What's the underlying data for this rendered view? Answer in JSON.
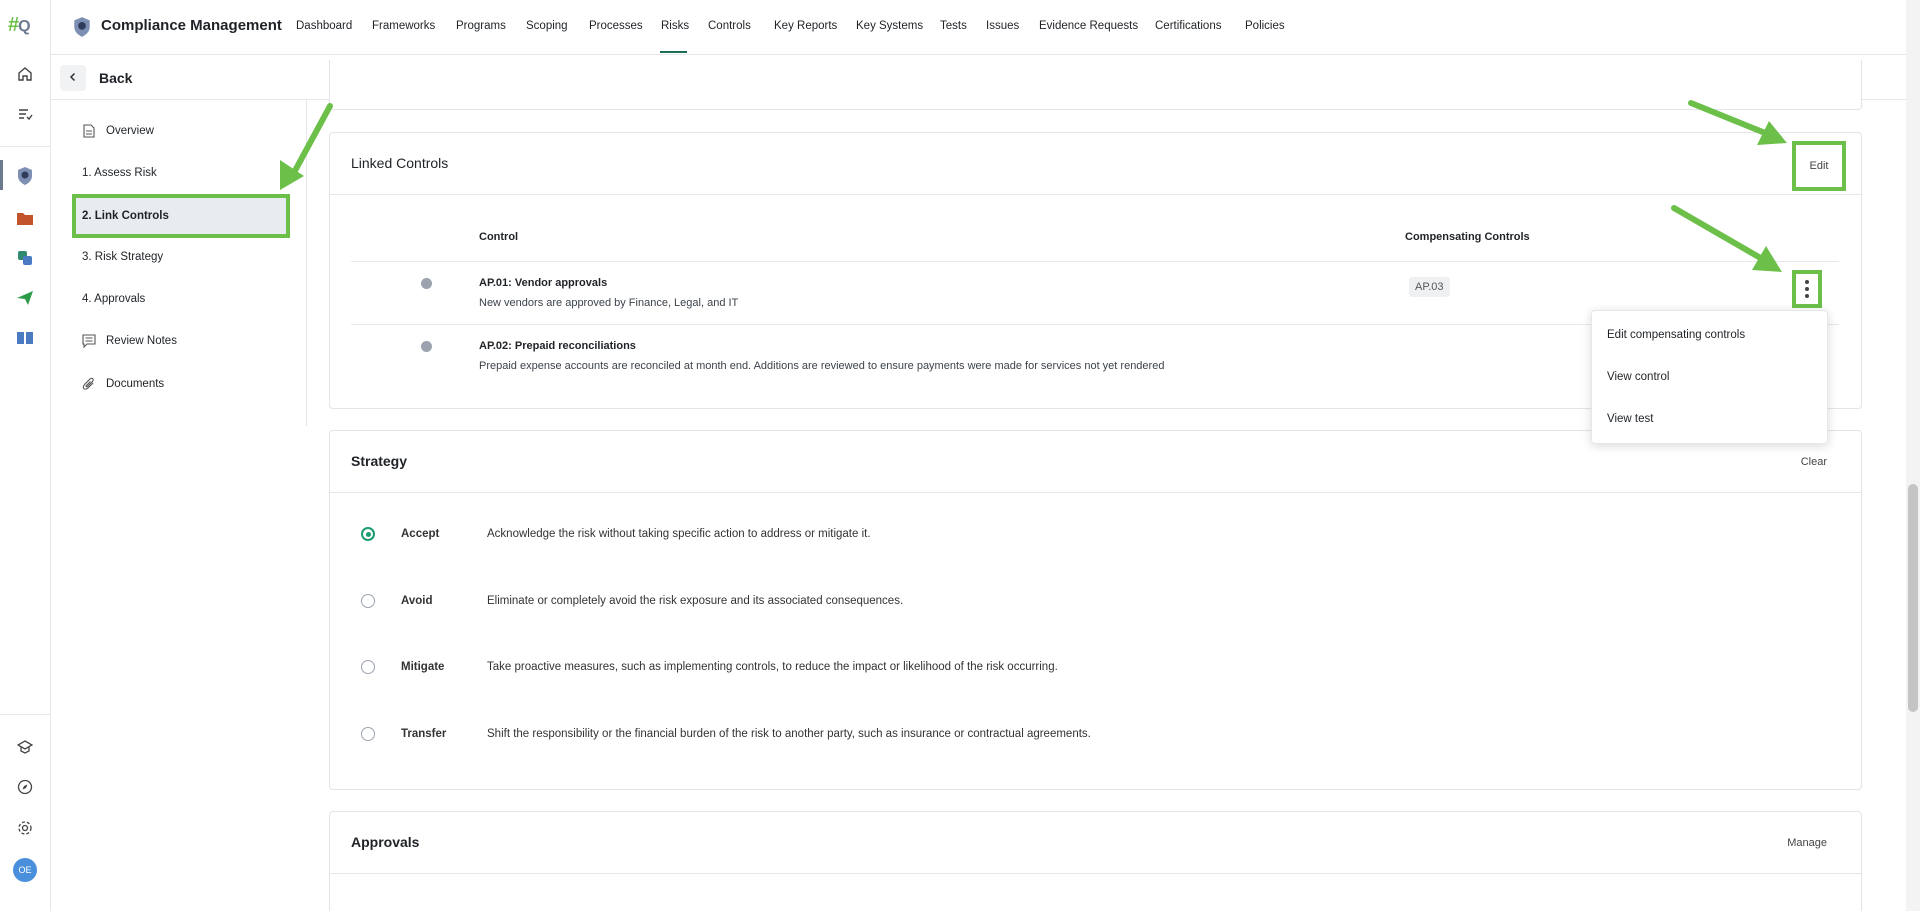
{
  "rail": {
    "logo_main": "#",
    "logo_sub": "Q",
    "avatar_initials": "OE"
  },
  "header": {
    "app_title": "Compliance Management",
    "nav": [
      "Dashboard",
      "Frameworks",
      "Programs",
      "Scoping",
      "Processes",
      "Risks",
      "Controls",
      "Key Reports",
      "Key Systems",
      "Tests",
      "Issues",
      "Evidence Requests",
      "Certifications",
      "Policies"
    ],
    "active_nav": "Risks"
  },
  "back": {
    "label": "Back"
  },
  "sidebar": {
    "items": [
      {
        "label": "Overview",
        "icon": "document-icon"
      },
      {
        "label": "1. Assess Risk",
        "icon": ""
      },
      {
        "label": "2. Link Controls",
        "icon": ""
      },
      {
        "label": "3. Risk Strategy",
        "icon": ""
      },
      {
        "label": "4. Approvals",
        "icon": ""
      },
      {
        "label": "Review Notes",
        "icon": "comment-icon"
      },
      {
        "label": "Documents",
        "icon": "paperclip-icon"
      }
    ],
    "active_index": 2
  },
  "linked_controls": {
    "title": "Linked Controls",
    "edit_label": "Edit",
    "columns": {
      "control": "Control",
      "compensating": "Compensating Controls"
    },
    "rows": [
      {
        "title": "AP.01: Vendor approvals",
        "description": "New vendors are approved by Finance, Legal, and IT",
        "compensating": "AP.03"
      },
      {
        "title": "AP.02: Prepaid reconciliations",
        "description": "Prepaid expense accounts are reconciled at month end. Additions are reviewed to ensure payments were made for services not yet rendered",
        "compensating": ""
      }
    ],
    "menu": [
      "Edit compensating controls",
      "View control",
      "View test"
    ]
  },
  "strategy": {
    "title": "Strategy",
    "clear_label": "Clear",
    "options": [
      {
        "label": "Accept",
        "description": "Acknowledge the risk without taking specific action to address or mitigate it.",
        "selected": true
      },
      {
        "label": "Avoid",
        "description": "Eliminate or completely avoid the risk exposure and its associated consequences.",
        "selected": false
      },
      {
        "label": "Mitigate",
        "description": "Take proactive measures, such as implementing controls, to reduce the impact or likelihood of the risk occurring.",
        "selected": false
      },
      {
        "label": "Transfer",
        "description": "Shift the responsibility or the financial burden of the risk to another party, such as insurance or contractual agreements.",
        "selected": false
      }
    ]
  },
  "approvals": {
    "title": "Approvals",
    "manage_label": "Manage"
  },
  "colors": {
    "accent_green": "#6cc04a",
    "brand_teal": "#1a6f57",
    "radio_green": "#1a9c73"
  }
}
